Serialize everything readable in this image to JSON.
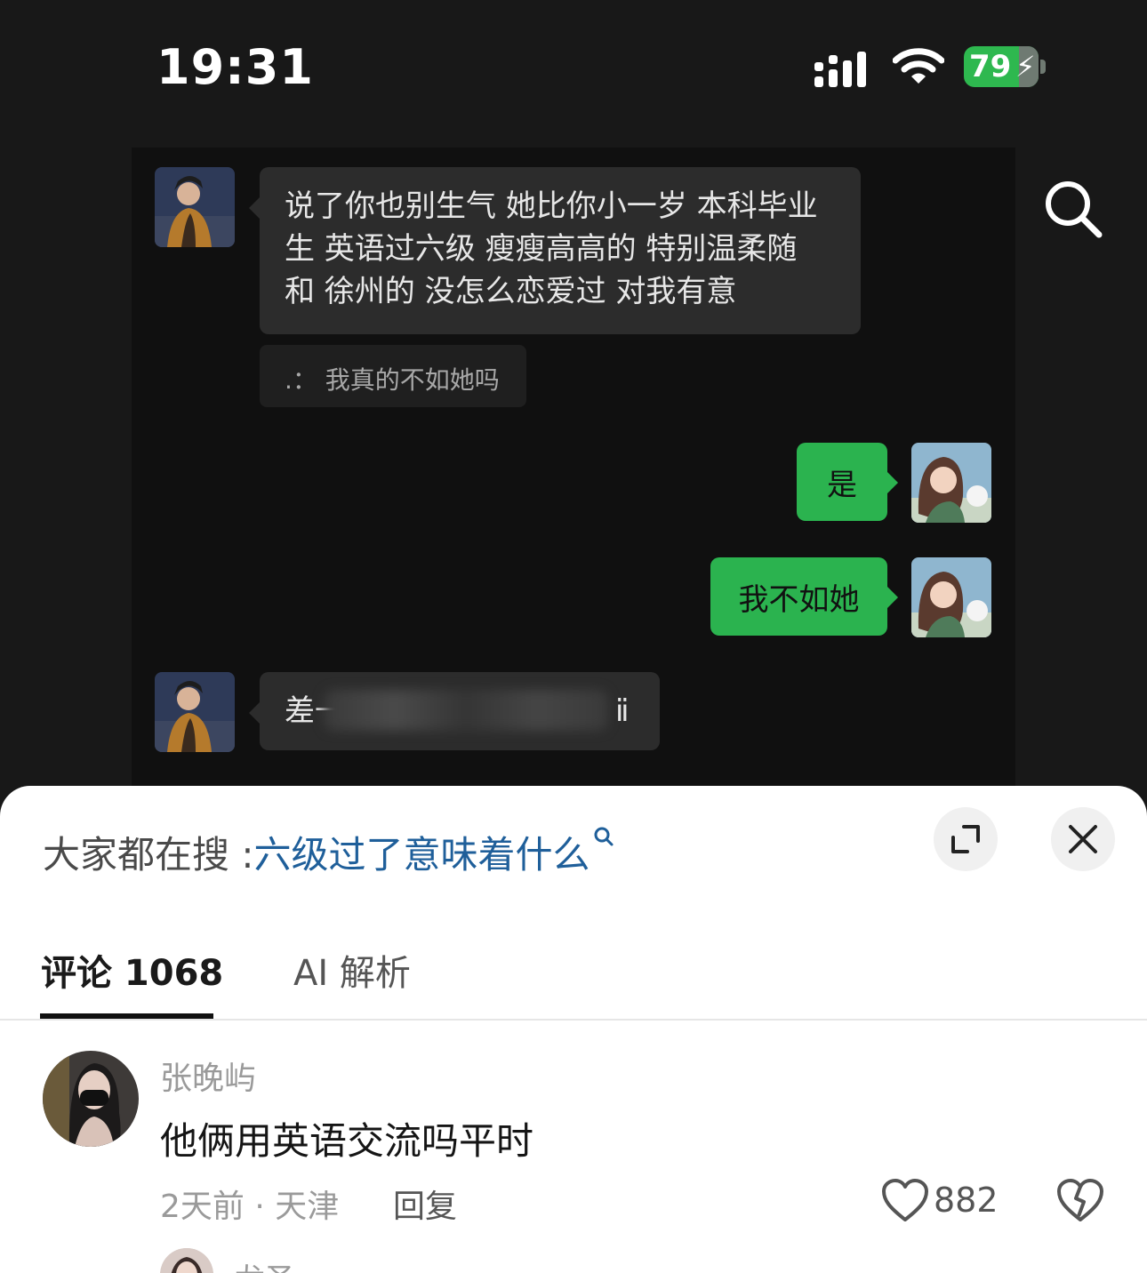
{
  "status_bar": {
    "time": "19:31",
    "battery": "79",
    "battery_color": "#2eb84f"
  },
  "chat": {
    "messages": [
      {
        "side": "left",
        "text": "说了你也别生气  她比你小一岁 本科毕业生 英语过六级 瘦瘦高高的 特别温柔随和  徐州的  没怎么恋爱过  对我有意"
      },
      {
        "side": "quote",
        "text": ".：  我真的不如她吗"
      },
      {
        "side": "right",
        "text": "是"
      },
      {
        "side": "right",
        "text": "我不如她"
      },
      {
        "side": "left",
        "text_visible_start": "差一",
        "text_visible_end": "ⅱ"
      }
    ],
    "bubble_green": "#2bb34f",
    "bubble_dark": "#2c2c2c"
  },
  "sheet": {
    "hot_search_prefix": "大家都在搜 :",
    "hot_search_keyword": "六级过了意味着什么",
    "keyword_color": "#1f5f9a",
    "tabs": [
      {
        "label": "评论 1068",
        "active": true
      },
      {
        "label": "AI 解析",
        "active": false
      }
    ],
    "comments": [
      {
        "user": "张晚屿",
        "text": "他俩用英语交流吗平时",
        "meta": "2天前 · 天津",
        "reply_label": "回复",
        "likes": "882"
      },
      {
        "user": "龙圣"
      }
    ]
  }
}
